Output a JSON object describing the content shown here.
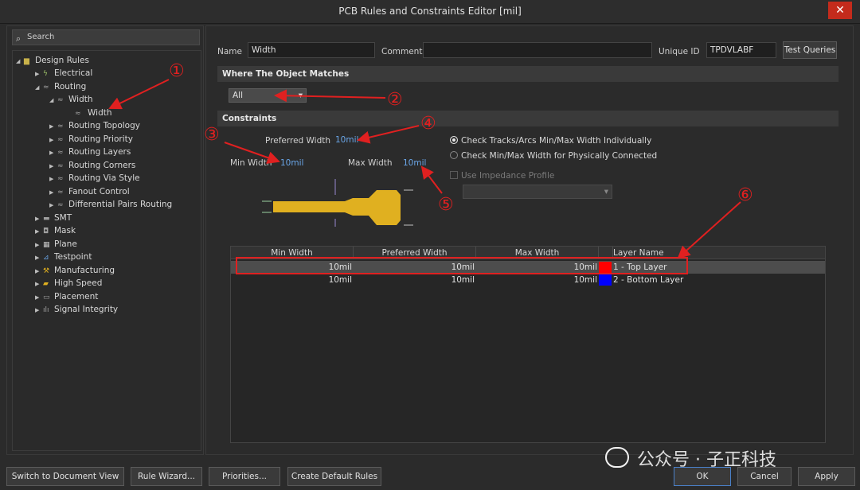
{
  "window": {
    "title": "PCB Rules and Constraints Editor [mil]",
    "close_glyph": "✕"
  },
  "search": {
    "placeholder": "Search"
  },
  "tree": {
    "root": "Design Rules",
    "electrical": "Electrical",
    "routing": "Routing",
    "width_group": "Width",
    "width_rule": "Width",
    "routing_topology": "Routing Topology",
    "routing_priority": "Routing Priority",
    "routing_layers": "Routing Layers",
    "routing_corners": "Routing Corners",
    "routing_via_style": "Routing Via Style",
    "fanout_control": "Fanout Control",
    "differential_pairs_routing": "Differential Pairs Routing",
    "smt": "SMT",
    "mask": "Mask",
    "plane": "Plane",
    "testpoint": "Testpoint",
    "manufacturing": "Manufacturing",
    "high_speed": "High Speed",
    "placement": "Placement",
    "signal_integrity": "Signal Integrity"
  },
  "header": {
    "name_label": "Name",
    "name_value": "Width",
    "comment_label": "Comment",
    "comment_value": "",
    "unique_id_label": "Unique ID",
    "unique_id_value": "TPDVLABF",
    "test_queries": "Test Queries"
  },
  "matches": {
    "title": "Where The Object Matches",
    "scope": "All"
  },
  "constraints": {
    "title": "Constraints",
    "preferred_width_label": "Preferred Width",
    "preferred_width_value": "10mil",
    "min_width_label": "Min Width",
    "min_width_value": "10mil",
    "max_width_label": "Max Width",
    "max_width_value": "10mil",
    "option_individual": "Check Tracks/Arcs Min/Max Width Individually",
    "option_connected": "Check Min/Max Width for Physically Connected",
    "use_impedance": "Use Impedance Profile",
    "profile_select": ""
  },
  "table": {
    "headers": [
      "Min Width",
      "Preferred Width",
      "Max Width",
      "Layer Name"
    ],
    "rows": [
      {
        "min": "10mil",
        "pref": "10mil",
        "max": "10mil",
        "color": "#ff0000",
        "layer": "1 - Top Layer"
      },
      {
        "min": "10mil",
        "pref": "10mil",
        "max": "10mil",
        "color": "#0000ff",
        "layer": "2 - Bottom Layer"
      }
    ]
  },
  "footer": {
    "switch_view": "Switch to Document View",
    "rule_wizard": "Rule Wizard...",
    "priorities": "Priorities...",
    "create_defaults": "Create Default Rules",
    "ok": "OK",
    "cancel": "Cancel",
    "apply": "Apply"
  },
  "annotations": [
    "①",
    "②",
    "③",
    "④",
    "⑤",
    "⑥"
  ],
  "watermark": "公众号 · 子正科技",
  "colors": {
    "accent": "#4a6891",
    "annotation": "#e02020",
    "track": "#e0b020",
    "value": "#6aa6e8"
  }
}
